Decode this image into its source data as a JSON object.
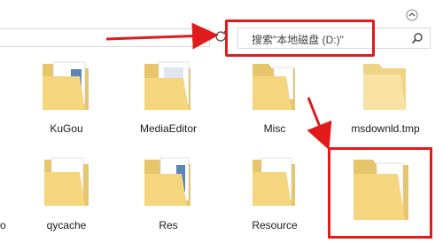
{
  "address": {
    "refresh_icon": "refresh-icon",
    "dropdown_icon": "chevron-down-icon"
  },
  "search": {
    "placeholder": "搜索\"本地磁盘 (D:)\"",
    "icon": "search-icon"
  },
  "top_icon": "chevron-up-icon",
  "left_cut_label": "o",
  "items": [
    {
      "name": "KuGou",
      "type": "folder-with-files"
    },
    {
      "name": "MediaEditor",
      "type": "folder-with-files"
    },
    {
      "name": "Misc",
      "type": "folder-with-file"
    },
    {
      "name": "msdownld.tmp",
      "type": "folder-empty"
    },
    {
      "name": "qycache",
      "type": "folder-with-files"
    },
    {
      "name": "Res",
      "type": "folder-with-files"
    },
    {
      "name": "Resource",
      "type": "folder-with-files"
    },
    {
      "name": "",
      "type": "folder-with-file"
    }
  ],
  "annotation_color": "#e11b1b"
}
